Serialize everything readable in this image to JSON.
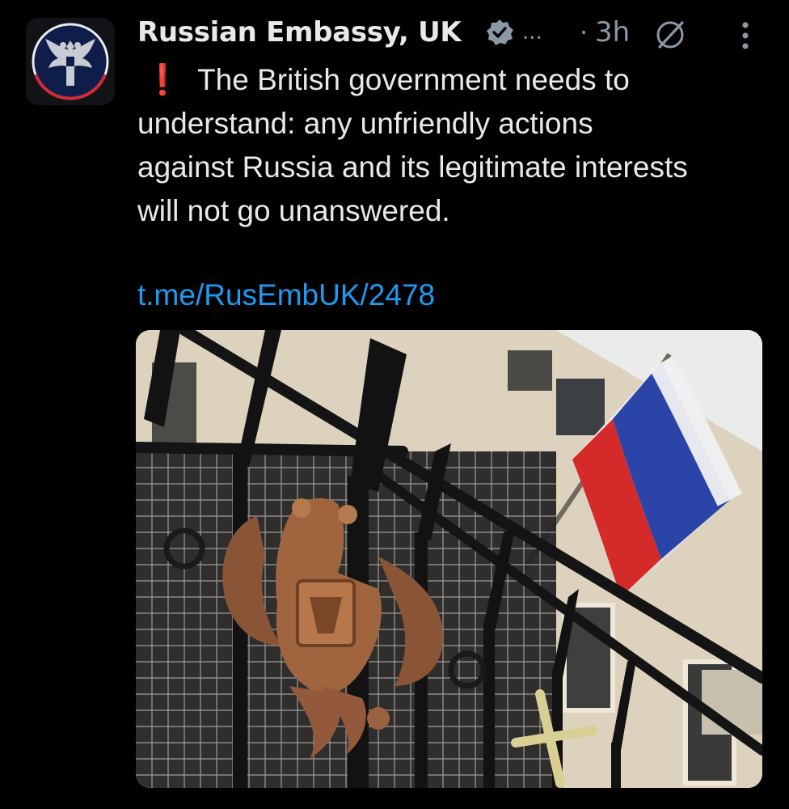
{
  "post": {
    "author_name": "Russian Embassy, UK",
    "name_overflow": "...",
    "separator": "·",
    "time": "3h",
    "body_lines": [
      "The British government needs to",
      "understand: any unfriendly actions",
      "against Russia and its legitimate interests",
      "will not go unanswered."
    ],
    "exclamation": "❗",
    "link_text": "t.me/RusEmbUK/2478"
  },
  "icons": {
    "avatar": "embassy-coat-of-arms-icon",
    "verified": "verified-badge-icon",
    "grok": "grok-icon",
    "more": "more-options-icon"
  },
  "colors": {
    "background": "#000000",
    "text": "#e7e9ea",
    "secondary": "#8b98a5",
    "link": "#1d9bf0",
    "exclamation": "#f4212e"
  }
}
